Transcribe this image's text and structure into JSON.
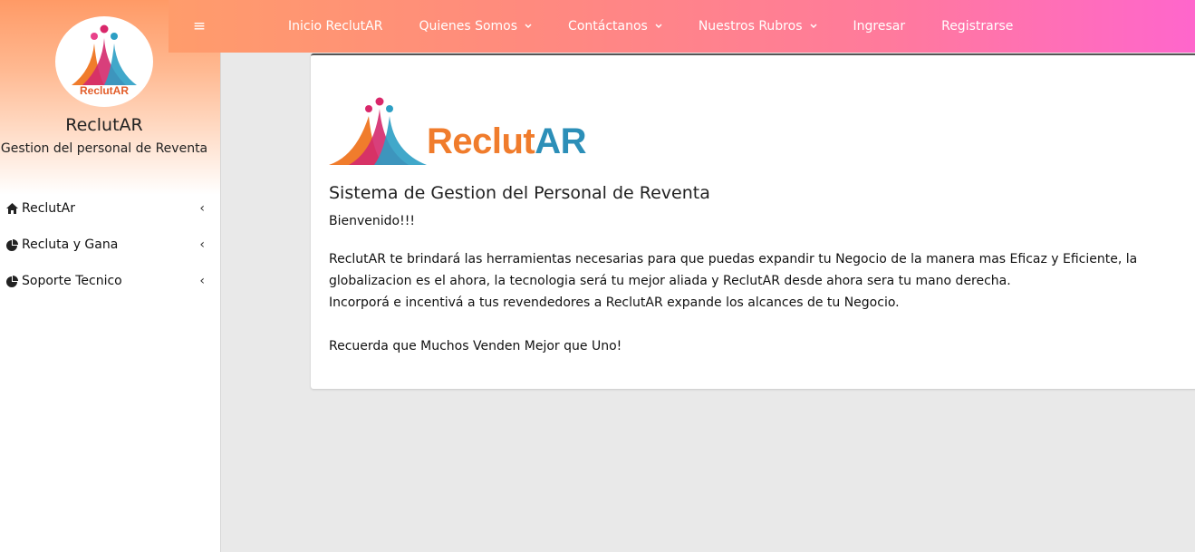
{
  "sidebar": {
    "logo_text": "ReclutAR",
    "brand_name": "ReclutAR",
    "brand_subtitle": "Gestion del personal de Reventa",
    "items": [
      {
        "label": "ReclutAr",
        "icon": "home-icon"
      },
      {
        "label": "Recluta y Gana",
        "icon": "pie-chart-icon"
      },
      {
        "label": "Soporte Tecnico",
        "icon": "pie-chart-icon"
      }
    ],
    "arrow": "‹"
  },
  "navbar": {
    "links": [
      {
        "label": "Inicio ReclutAR",
        "dropdown": false
      },
      {
        "label": "Quienes Somos",
        "dropdown": true
      },
      {
        "label": "Contáctanos",
        "dropdown": true
      },
      {
        "label": "Nuestros Rubros",
        "dropdown": true
      },
      {
        "label": "Ingresar",
        "dropdown": false
      },
      {
        "label": "Registrarse",
        "dropdown": false
      }
    ],
    "hamburger_icon": "≡"
  },
  "content": {
    "logo_word_prefix": "Reclut",
    "logo_word_suffix": "AR",
    "title": "Sistema de Gestion del Personal de Reventa",
    "welcome": "Bienvenido!!!",
    "paragraph1": "ReclutAR te brindará las herramientas necesarias para que puedas expandir tu Negocio de la manera mas Eficaz y Eficiente, la globalizacion es el ahora, la tecnologia será tu mejor aliada y ReclutAR desde ahora sera tu mano derecha.",
    "paragraph2": "Incorporá e incentivá a tus revendedores a ReclutAR expande los alcances de tu Negocio.",
    "paragraph3": "Recuerda que Muchos Venden Mejor que Uno!"
  },
  "colors": {
    "navbar_start": "#ff9c6b",
    "navbar_end": "#ff66cc",
    "logo_orange": "#f07c2c",
    "logo_blue": "#2c8fb8"
  }
}
